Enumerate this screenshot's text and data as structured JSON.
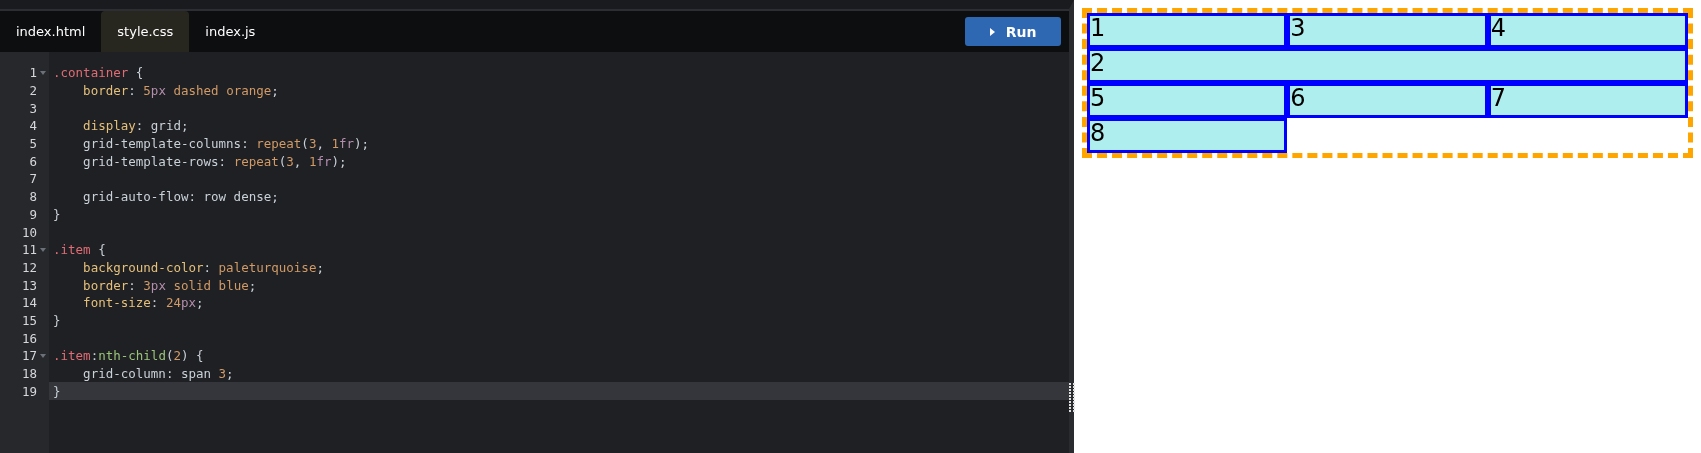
{
  "tabs": [
    {
      "label": "index.html",
      "selected": false
    },
    {
      "label": "style.css",
      "selected": true
    },
    {
      "label": "index.js",
      "selected": false
    }
  ],
  "run_button": {
    "label": "Run"
  },
  "editor": {
    "lines": [
      {
        "number": "1",
        "foldable": true,
        "active": false,
        "tokens": [
          {
            "kind": "sel",
            "t": ".container"
          },
          {
            "kind": "punct",
            "t": " {"
          }
        ]
      },
      {
        "number": "2",
        "foldable": false,
        "active": false,
        "tokens": [
          {
            "kind": "prop",
            "t": "    border"
          },
          {
            "kind": "punct",
            "t": ": "
          },
          {
            "kind": "num",
            "t": "5"
          },
          {
            "kind": "unit",
            "t": "px"
          },
          {
            "kind": "val",
            "t": " dashed orange"
          },
          {
            "kind": "punct",
            "t": ";"
          }
        ]
      },
      {
        "number": "3",
        "foldable": false,
        "active": false
      },
      {
        "number": "4",
        "foldable": false,
        "active": false,
        "tokens": [
          {
            "kind": "prop",
            "t": "    display"
          },
          {
            "kind": "punct",
            "t": ": grid;"
          }
        ]
      },
      {
        "number": "5",
        "foldable": false,
        "active": false,
        "tokens": [
          {
            "kind": "punct",
            "t": "    grid-template-columns: "
          },
          {
            "kind": "val",
            "t": "repeat"
          },
          {
            "kind": "punct",
            "t": "("
          },
          {
            "kind": "num",
            "t": "3"
          },
          {
            "kind": "punct",
            "t": ", "
          },
          {
            "kind": "num",
            "t": "1"
          },
          {
            "kind": "unit",
            "t": "fr"
          },
          {
            "kind": "punct",
            "t": ");"
          }
        ]
      },
      {
        "number": "6",
        "foldable": false,
        "active": false,
        "tokens": [
          {
            "kind": "punct",
            "t": "    grid-template-rows: "
          },
          {
            "kind": "val",
            "t": "repeat"
          },
          {
            "kind": "punct",
            "t": "("
          },
          {
            "kind": "num",
            "t": "3"
          },
          {
            "kind": "punct",
            "t": ", "
          },
          {
            "kind": "num",
            "t": "1"
          },
          {
            "kind": "unit",
            "t": "fr"
          },
          {
            "kind": "punct",
            "t": ");"
          }
        ]
      },
      {
        "number": "7",
        "foldable": false,
        "active": false
      },
      {
        "number": "8",
        "foldable": false,
        "active": false,
        "tokens": [
          {
            "kind": "punct",
            "t": "    grid-auto-flow: row dense;"
          }
        ]
      },
      {
        "number": "9",
        "foldable": false,
        "active": false,
        "tokens": [
          {
            "kind": "punct",
            "t": "}"
          }
        ]
      },
      {
        "number": "10",
        "foldable": false,
        "active": false
      },
      {
        "number": "11",
        "foldable": true,
        "active": false,
        "tokens": [
          {
            "kind": "sel",
            "t": ".item"
          },
          {
            "kind": "punct",
            "t": " {"
          }
        ]
      },
      {
        "number": "12",
        "foldable": false,
        "active": false,
        "tokens": [
          {
            "kind": "prop",
            "t": "    background-color"
          },
          {
            "kind": "punct",
            "t": ": "
          },
          {
            "kind": "val",
            "t": "paleturquoise"
          },
          {
            "kind": "punct",
            "t": ";"
          }
        ]
      },
      {
        "number": "13",
        "foldable": false,
        "active": false,
        "tokens": [
          {
            "kind": "prop",
            "t": "    border"
          },
          {
            "kind": "punct",
            "t": ": "
          },
          {
            "kind": "num",
            "t": "3"
          },
          {
            "kind": "unit",
            "t": "px"
          },
          {
            "kind": "val",
            "t": " solid blue"
          },
          {
            "kind": "punct",
            "t": ";"
          }
        ]
      },
      {
        "number": "14",
        "foldable": false,
        "active": false,
        "tokens": [
          {
            "kind": "prop",
            "t": "    font-size"
          },
          {
            "kind": "punct",
            "t": ": "
          },
          {
            "kind": "num",
            "t": "24"
          },
          {
            "kind": "unit",
            "t": "px"
          },
          {
            "kind": "punct",
            "t": ";"
          }
        ]
      },
      {
        "number": "15",
        "foldable": false,
        "active": false,
        "tokens": [
          {
            "kind": "punct",
            "t": "}"
          }
        ]
      },
      {
        "number": "16",
        "foldable": false,
        "active": false
      },
      {
        "number": "17",
        "foldable": true,
        "active": false,
        "tokens": [
          {
            "kind": "sel",
            "t": ".item"
          },
          {
            "kind": "punct",
            "t": ":"
          },
          {
            "kind": "pseudo",
            "t": "nth-child"
          },
          {
            "kind": "punct",
            "t": "("
          },
          {
            "kind": "num",
            "t": "2"
          },
          {
            "kind": "punct",
            "t": ") {"
          }
        ]
      },
      {
        "number": "18",
        "foldable": false,
        "active": false,
        "tokens": [
          {
            "kind": "punct",
            "t": "    grid-column: span "
          },
          {
            "kind": "num",
            "t": "3"
          },
          {
            "kind": "punct",
            "t": ";"
          }
        ]
      },
      {
        "number": "19",
        "foldable": false,
        "active": true,
        "tokens": [
          {
            "kind": "punct",
            "t": "}"
          }
        ]
      }
    ]
  },
  "preview": {
    "items": [
      {
        "label": "1"
      },
      {
        "label": "2"
      },
      {
        "label": "3"
      },
      {
        "label": "4"
      },
      {
        "label": "5"
      },
      {
        "label": "6"
      },
      {
        "label": "7"
      },
      {
        "label": "8"
      }
    ]
  }
}
